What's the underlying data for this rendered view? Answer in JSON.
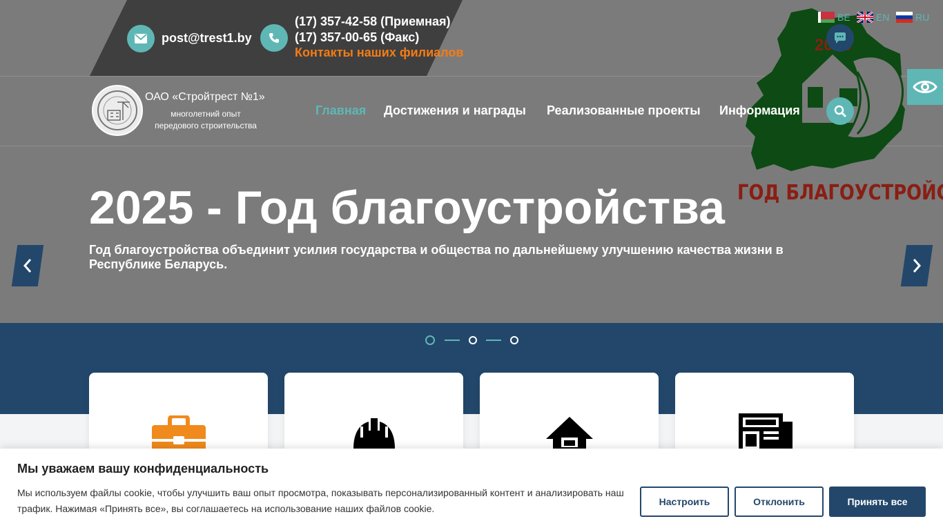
{
  "header": {
    "email": "post@trest1.by",
    "phone_reception": "(17) 357-42-58 (Приемная)",
    "phone_fax": "(17) 357-00-65 (Факс)",
    "branches_link": "Контакты наших филиалов"
  },
  "languages": [
    {
      "code": "BE",
      "icon": "belarus-flag-icon"
    },
    {
      "code": "EN",
      "icon": "uk-flag-icon"
    },
    {
      "code": "RU",
      "icon": "russia-flag-icon"
    }
  ],
  "emblem": {
    "year": "2025",
    "caption": "ГОД БЛАГОУСТРОЙСТВА"
  },
  "brand": {
    "name": "ОАО «Стройтрест №1»",
    "tagline": "многолетний опыт передового строительства"
  },
  "nav": {
    "items": [
      {
        "label": "Главная",
        "active": true
      },
      {
        "label": "Достижения и награды",
        "active": false
      },
      {
        "label": "Реализованные проекты",
        "active": false
      },
      {
        "label": "Информация",
        "active": false
      }
    ]
  },
  "hero": {
    "title": "2025 - Год благоустройства",
    "text": "Год благоустройства объединит усилия государства и общества по дальнейшему улучшению качества жизни в Республике Беларусь.",
    "slide_count": 3,
    "active_slide": 1
  },
  "cards": [
    {
      "icon": "briefcase-icon",
      "color": "#f08a1c"
    },
    {
      "icon": "hard-hat-icon",
      "color": "#000000"
    },
    {
      "icon": "house-icon",
      "color": "#000000"
    },
    {
      "icon": "newspaper-icon",
      "color": "#000000"
    }
  ],
  "cookie": {
    "title": "Мы уважаем вашу конфиденциальность",
    "text": "Мы используем файлы cookie, чтобы улучшить ваш опыт просмотра, показывать персонализированный контент и анализировать наш трафик. Нажимая «Принять все», вы соглашаетесь на использование наших файлов cookie.",
    "customize_label": "Настроить",
    "reject_label": "Отклонить",
    "accept_label": "Принять все"
  },
  "colors": {
    "accent": "#5fb7b5",
    "navy": "#23476b",
    "orange": "#f47c16"
  }
}
